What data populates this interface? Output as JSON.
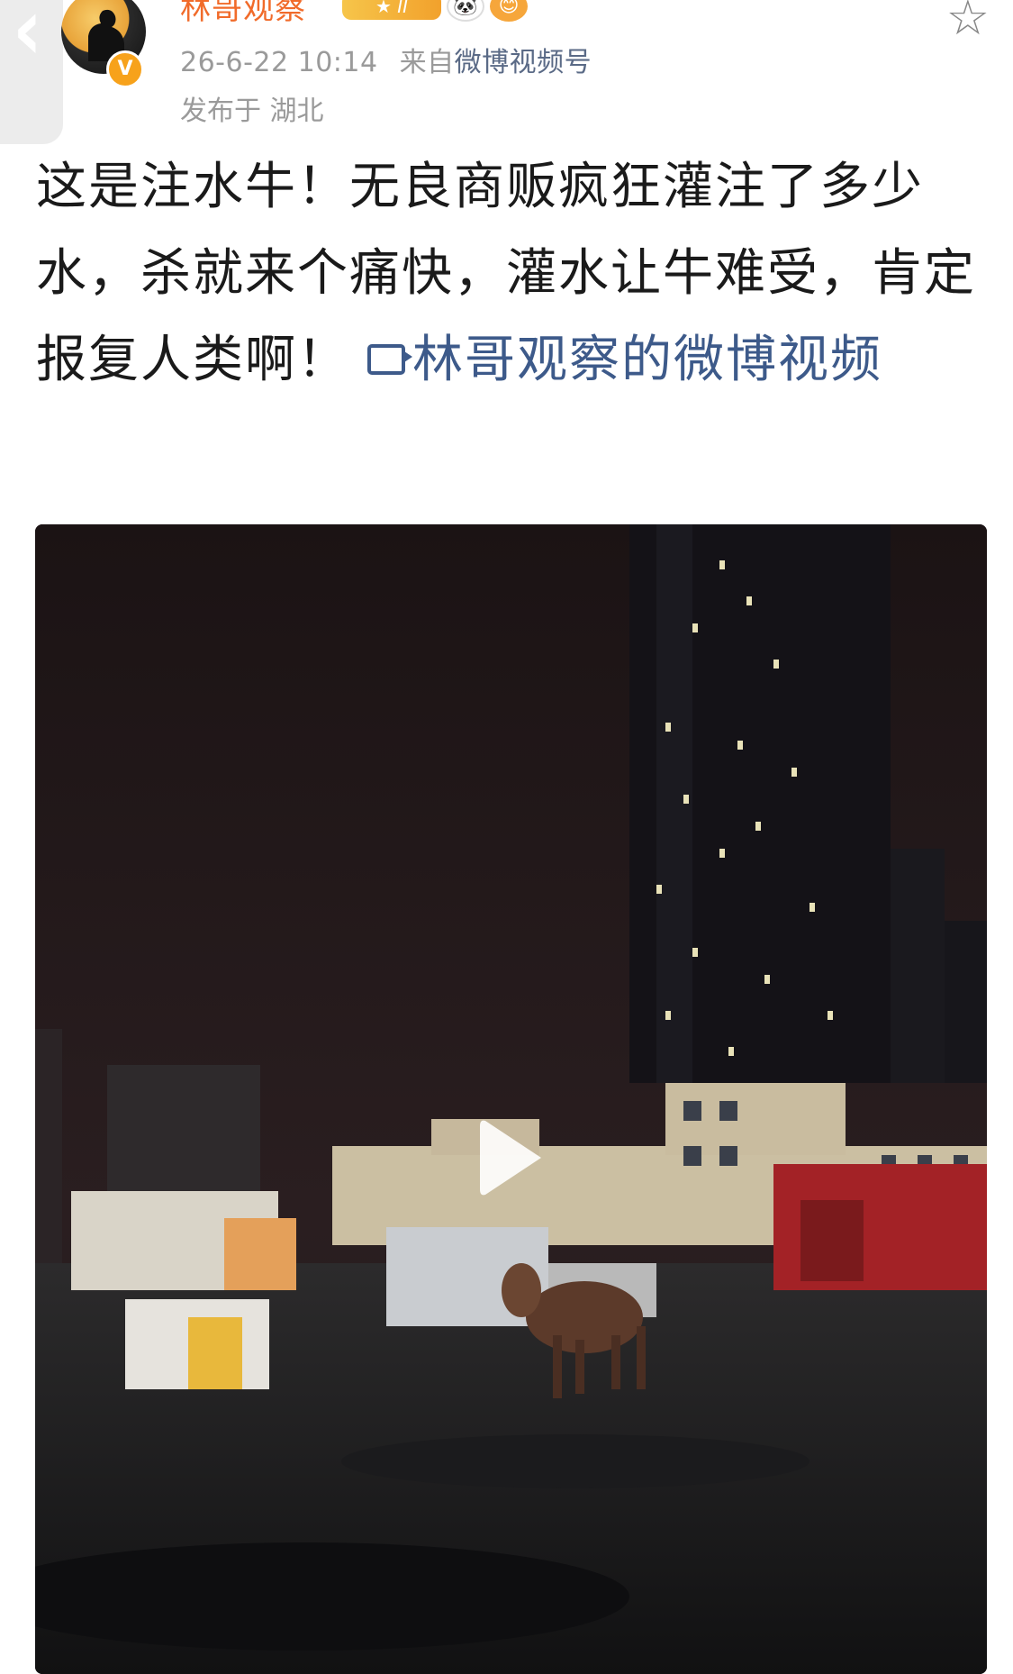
{
  "post": {
    "author": "林哥观察",
    "timestamp": "26-6-22 10:14",
    "source_prefix": "来自",
    "source": "微博视频号",
    "location": "发布于 湖北",
    "text": "这是注水牛！无良商贩疯狂灌注了多少水，杀就来个痛快，灌水让牛难受，肯定报复人类啊！",
    "video_link": "林哥观察的微博视频",
    "verified_badge": "V",
    "vip_badge": "II"
  },
  "icons": {
    "back": "chevron-left-icon",
    "favorite": "star-icon",
    "play": "play-icon",
    "video_link": "video-camera-icon"
  },
  "colors": {
    "username": "#f16b2a",
    "link": "#3d5a8a",
    "meta": "#9a9a9a",
    "badge": "#f7a21b"
  }
}
